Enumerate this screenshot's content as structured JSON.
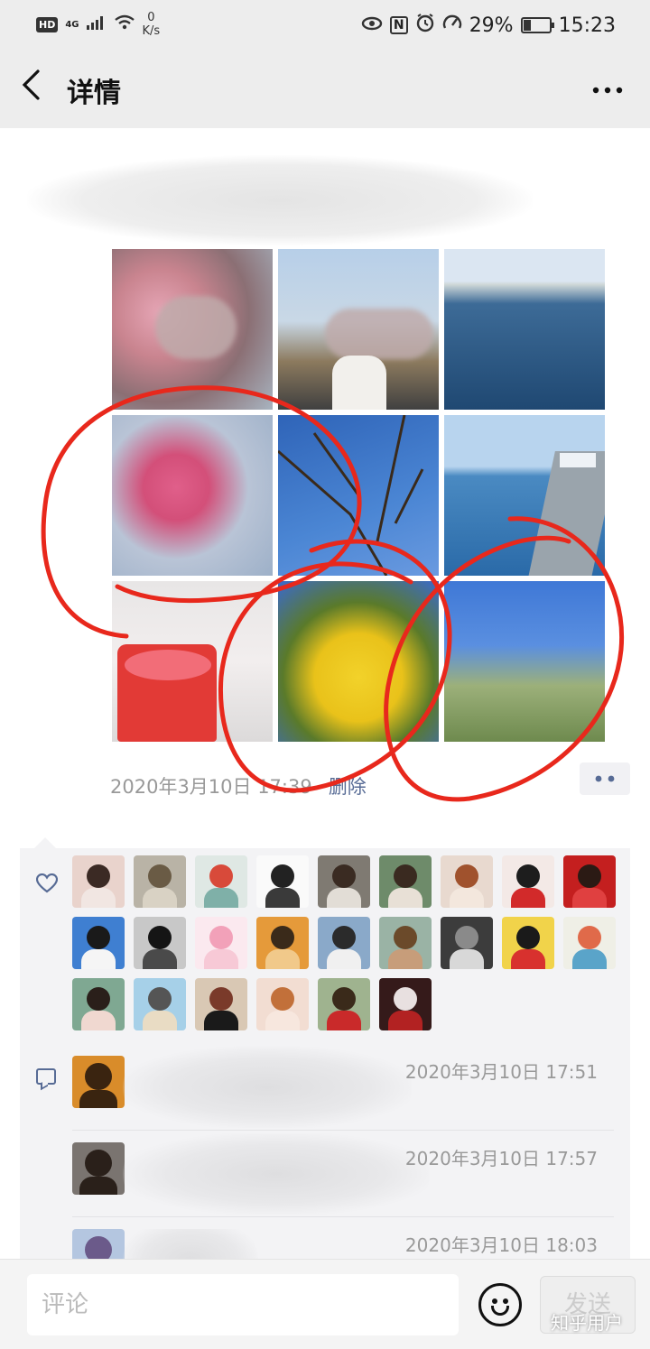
{
  "status_bar": {
    "hd_badge": "HD",
    "network": "4G",
    "net_speed_value": "0",
    "net_speed_unit": "K/s",
    "nfc_label": "N",
    "battery": "29%",
    "battery_level": 0.29,
    "time": "15:23"
  },
  "header": {
    "back_icon": "chevron-left-icon",
    "title": "详情",
    "more_icon": "more-icon"
  },
  "post": {
    "photos": [
      {
        "name": "plum-blossom-portrait"
      },
      {
        "name": "road-portrait"
      },
      {
        "name": "canal"
      },
      {
        "name": "pink-blossom"
      },
      {
        "name": "white-blossom-sky"
      },
      {
        "name": "canal-gate"
      },
      {
        "name": "red-cup"
      },
      {
        "name": "rapeseed-flower"
      },
      {
        "name": "willow-tree"
      }
    ],
    "time": "2020年3月10日 17:39",
    "delete_label": "删除"
  },
  "likes": {
    "icon": "heart-icon",
    "avatars": [
      {
        "bg": "#e9d3cc",
        "fig": "#3b2a24",
        "body": "#f1e6e2"
      },
      {
        "bg": "#b9b3a6",
        "fig": "#6a5b45",
        "body": "#d9d2c4"
      },
      {
        "bg": "#dfe8e4",
        "fig": "#d84a3a",
        "body": "#7fb0a8"
      },
      {
        "bg": "#fafafa",
        "fig": "#222222",
        "body": "#3a3a3a"
      },
      {
        "bg": "#7f7a72",
        "fig": "#3a2b22",
        "body": "#e2ddd6"
      },
      {
        "bg": "#6e8b6a",
        "fig": "#3a2a20",
        "body": "#e8e0d6"
      },
      {
        "bg": "#e8d9cf",
        "fig": "#a0522d",
        "body": "#f3e7dd"
      },
      {
        "bg": "#f3e9e6",
        "fig": "#1d1d1d",
        "body": "#d22a2a"
      },
      {
        "bg": "#c41f1f",
        "fig": "#2b1a14",
        "body": "#e04040"
      },
      {
        "bg": "#3f7fd1",
        "fig": "#1a1a1a",
        "body": "#f5f5f5"
      },
      {
        "bg": "#c8c8c8",
        "fig": "#151515",
        "body": "#4a4a4a"
      },
      {
        "bg": "#fbe9ef",
        "fig": "#f2a1b9",
        "body": "#f7c9d6"
      },
      {
        "bg": "#e59a3a",
        "fig": "#3a2a1a",
        "body": "#f1c98a"
      },
      {
        "bg": "#8aa9c9",
        "fig": "#2b2b2b",
        "body": "#f0f0f0"
      },
      {
        "bg": "#9ab3a5",
        "fig": "#6b4a2a",
        "body": "#c79d7a"
      },
      {
        "bg": "#3c3c3c",
        "fig": "#8a8a8a",
        "body": "#d8d8d8"
      },
      {
        "bg": "#f1d34a",
        "fig": "#1a1a1a",
        "body": "#d8312e"
      },
      {
        "bg": "#efefe6",
        "fig": "#e06a4a",
        "body": "#5aa4c9"
      },
      {
        "bg": "#7fa892",
        "fig": "#2a1f1a",
        "body": "#f0d8d0"
      },
      {
        "bg": "#a6d0e8",
        "fig": "#555555",
        "body": "#e9dcc4"
      },
      {
        "bg": "#d9c8b4",
        "fig": "#7a3a2a",
        "body": "#1a1a1a"
      },
      {
        "bg": "#f2ddd2",
        "fig": "#c2703a",
        "body": "#f7e7de"
      },
      {
        "bg": "#9fb38f",
        "fig": "#3a2a1a",
        "body": "#c92a2a"
      },
      {
        "bg": "#351a1a",
        "fig": "#e8e0e0",
        "body": "#b22222"
      }
    ]
  },
  "comments": {
    "icon": "comment-icon",
    "items": [
      {
        "time": "2020年3月10日 17:51",
        "avatar_bg": "#d98c2a",
        "avatar_fig": "#3a2410"
      },
      {
        "time": "2020年3月10日 17:57",
        "avatar_bg": "#7a7470",
        "avatar_fig": "#2a201a"
      },
      {
        "time": "2020年3月10日 18:03",
        "avatar_bg": "#b4c6e0",
        "avatar_fig": "#6b5a8a"
      }
    ]
  },
  "input_bar": {
    "placeholder": "评论",
    "emoji_icon": "emoji-icon",
    "send_label": "发送"
  },
  "watermark": "知乎用户",
  "colors": {
    "link": "#576b95",
    "annotation": "#e8281c",
    "panel_bg": "#f3f3f5",
    "header_bg": "#ededed"
  }
}
